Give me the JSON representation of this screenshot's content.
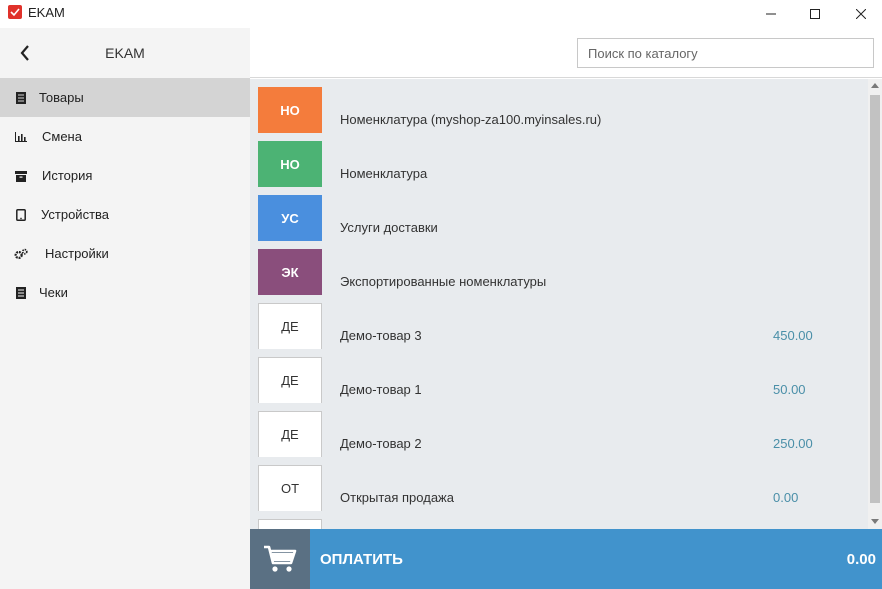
{
  "window": {
    "title": "EKAM",
    "brand_color": "#e0322b"
  },
  "sidebar": {
    "title": "EKAM",
    "items": [
      {
        "label": "Товары",
        "icon": "document-list-icon",
        "active": true
      },
      {
        "label": "Смена",
        "icon": "bar-chart-icon",
        "active": false
      },
      {
        "label": "История",
        "icon": "archive-box-icon",
        "active": false
      },
      {
        "label": "Устройства",
        "icon": "tablet-icon",
        "active": false
      },
      {
        "label": "Настройки",
        "icon": "gears-icon",
        "active": false
      },
      {
        "label": "Чеки",
        "icon": "receipt-icon",
        "active": false
      }
    ]
  },
  "search": {
    "placeholder": "Поиск по каталогу",
    "value": ""
  },
  "catalog": {
    "items": [
      {
        "abbr": "НО",
        "name": "Номенклатура (myshop-za100.myinsales.ru)",
        "price": "",
        "color": "#f47c3c"
      },
      {
        "abbr": "НО",
        "name": "Номенклатура",
        "price": "",
        "color": "#4cb374"
      },
      {
        "abbr": "УС",
        "name": "Услуги доставки",
        "price": "",
        "color": "#4a8fde"
      },
      {
        "abbr": "ЭК",
        "name": "Экспортированные номенклатуры",
        "price": "",
        "color": "#8a4e7c"
      },
      {
        "abbr": "ДЕ",
        "name": "Демо-товар 3",
        "price": "450.00",
        "color": ""
      },
      {
        "abbr": "ДЕ",
        "name": "Демо-товар 1",
        "price": "50.00",
        "color": ""
      },
      {
        "abbr": "ДЕ",
        "name": "Демо-товар 2",
        "price": "250.00",
        "color": ""
      },
      {
        "abbr": "ОТ",
        "name": "Открытая продажа",
        "price": "0.00",
        "color": ""
      },
      {
        "abbr": "",
        "name": "",
        "price": "",
        "color": ""
      }
    ]
  },
  "pay": {
    "label": "ОПЛАТИТЬ",
    "total": "0.00",
    "color": "#4193cc"
  }
}
